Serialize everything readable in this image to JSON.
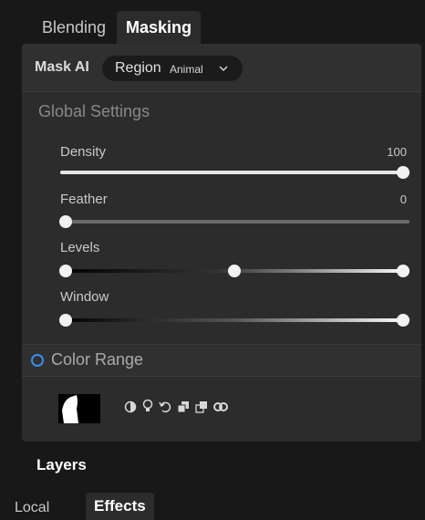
{
  "top_tabs": [
    {
      "label": "Blending",
      "active": false
    },
    {
      "label": "Masking",
      "active": true
    }
  ],
  "mask_ai": {
    "label": "Mask AI",
    "region_label": "Region",
    "region_value": "Animal"
  },
  "global_settings": {
    "title": "Global Settings",
    "sliders": [
      {
        "label": "Density",
        "value": "100",
        "level": 1.0
      },
      {
        "label": "Feather",
        "value": "0",
        "level": 0.0
      },
      {
        "label": "Levels",
        "value": "",
        "levels": [
          0.0,
          0.5,
          1.0
        ]
      },
      {
        "label": "Window",
        "value": "",
        "levels": [
          0.0,
          1.0
        ]
      }
    ]
  },
  "color_range": {
    "label": "Color Range",
    "radio_color": "#3b8eea"
  },
  "tools": {
    "icons": [
      "contrast-icon",
      "lightbulb-icon",
      "undo-icon",
      "copy-mask-icon",
      "paste-mask-icon",
      "view-mask-icon"
    ]
  },
  "layers": {
    "title": "Layers",
    "tabs": [
      {
        "label": "Local",
        "active": false
      },
      {
        "label": "Effects",
        "active": true
      }
    ]
  },
  "colors": {
    "background": "#181818",
    "panel": "#2c2c2c",
    "accent": "#3b8eea"
  }
}
